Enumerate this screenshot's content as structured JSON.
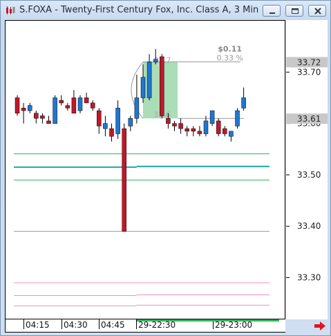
{
  "window": {
    "title": "S.FOXA - Twenty-First Century Fox, Inc. Class A, 3 Min",
    "buttons": {
      "minimize": "minimize",
      "maximize": "maximize",
      "close": "close"
    }
  },
  "price_axis": {
    "ticks": [
      "33.70",
      "33.60",
      "33.50",
      "33.40",
      "33.30"
    ],
    "last_price_label": "33.72",
    "marker_label": "33.61"
  },
  "time_axis": {
    "labels": [
      "04:15",
      "04:30",
      "04:45",
      "29-22:30",
      "29-23:00"
    ]
  },
  "annotation": {
    "change_value": "$0.11",
    "change_percent": "0.33 %",
    "low_label": "33.6",
    "high_label": "33.7"
  },
  "colors": {
    "up": "#1f77d0",
    "down": "#c0182a",
    "highlight": "#8fd19e",
    "hline_green": "#2db35a",
    "hline_teal": "#19a3a8",
    "hline_pink": "#f08fc0",
    "hline_gray": "#999999",
    "axis_marker": "#c8c8c8"
  },
  "icons": {
    "app": "candlestick-app-icon",
    "scroll": "red-right-arrow-icon"
  },
  "chart_data": {
    "type": "candlestick",
    "title": "S.FOXA - Twenty-First Century Fox, Inc. Class A, 3 Min",
    "yrange": [
      33.245,
      33.76
    ],
    "y_ticks": [
      33.7,
      33.6,
      33.5,
      33.4,
      33.3
    ],
    "x_labels": [
      "04:15",
      "04:30",
      "04:45",
      "29-22:30",
      "29-23:00"
    ],
    "candles": [
      {
        "o": 33.65,
        "h": 33.655,
        "l": 33.615,
        "c": 33.62
      },
      {
        "o": 33.63,
        "h": 33.64,
        "l": 33.6,
        "c": 33.625
      },
      {
        "o": 33.625,
        "h": 33.64,
        "l": 33.62,
        "c": 33.635
      },
      {
        "o": 33.62,
        "h": 33.625,
        "l": 33.6,
        "c": 33.61
      },
      {
        "o": 33.615,
        "h": 33.62,
        "l": 33.6,
        "c": 33.61
      },
      {
        "o": 33.605,
        "h": 33.615,
        "l": 33.6,
        "c": 33.6
      },
      {
        "o": 33.6,
        "h": 33.655,
        "l": 33.6,
        "c": 33.65
      },
      {
        "o": 33.645,
        "h": 33.655,
        "l": 33.635,
        "c": 33.64
      },
      {
        "o": 33.635,
        "h": 33.64,
        "l": 33.625,
        "c": 33.63
      },
      {
        "o": 33.65,
        "h": 33.665,
        "l": 33.625,
        "c": 33.62
      },
      {
        "o": 33.625,
        "h": 33.655,
        "l": 33.62,
        "c": 33.65
      },
      {
        "o": 33.65,
        "h": 33.66,
        "l": 33.64,
        "c": 33.64
      },
      {
        "o": 33.64,
        "h": 33.645,
        "l": 33.625,
        "c": 33.63
      },
      {
        "o": 33.625,
        "h": 33.63,
        "l": 33.58,
        "c": 33.595
      },
      {
        "o": 33.59,
        "h": 33.615,
        "l": 33.575,
        "c": 33.6
      },
      {
        "o": 33.59,
        "h": 33.6,
        "l": 33.565,
        "c": 33.575
      },
      {
        "o": 33.58,
        "h": 33.645,
        "l": 33.57,
        "c": 33.63
      },
      {
        "o": 33.59,
        "h": 33.6,
        "l": 33.39,
        "c": 33.39
      },
      {
        "o": 33.595,
        "h": 33.615,
        "l": 33.585,
        "c": 33.61
      },
      {
        "o": 33.61,
        "h": 33.695,
        "l": 33.6,
        "c": 33.65
      },
      {
        "o": 33.65,
        "h": 33.715,
        "l": 33.64,
        "c": 33.69
      },
      {
        "o": 33.65,
        "h": 33.735,
        "l": 33.645,
        "c": 33.72
      },
      {
        "o": 33.72,
        "h": 33.745,
        "l": 33.715,
        "c": 33.725
      },
      {
        "o": 33.73,
        "h": 33.735,
        "l": 33.61,
        "c": 33.615
      },
      {
        "o": 33.61,
        "h": 33.62,
        "l": 33.59,
        "c": 33.6
      },
      {
        "o": 33.6,
        "h": 33.605,
        "l": 33.585,
        "c": 33.595
      },
      {
        "o": 33.6,
        "h": 33.61,
        "l": 33.58,
        "c": 33.59
      },
      {
        "o": 33.59,
        "h": 33.595,
        "l": 33.575,
        "c": 33.585
      },
      {
        "o": 33.59,
        "h": 33.595,
        "l": 33.575,
        "c": 33.585
      },
      {
        "o": 33.585,
        "h": 33.595,
        "l": 33.575,
        "c": 33.58
      },
      {
        "o": 33.58,
        "h": 33.615,
        "l": 33.575,
        "c": 33.605
      },
      {
        "o": 33.6,
        "h": 33.625,
        "l": 33.595,
        "c": 33.625
      },
      {
        "o": 33.605,
        "h": 33.61,
        "l": 33.575,
        "c": 33.58
      },
      {
        "o": 33.59,
        "h": 33.595,
        "l": 33.575,
        "c": 33.58
      },
      {
        "o": 33.575,
        "h": 33.585,
        "l": 33.565,
        "c": 33.585
      },
      {
        "o": 33.595,
        "h": 33.63,
        "l": 33.59,
        "c": 33.625
      },
      {
        "o": 33.63,
        "h": 33.67,
        "l": 33.625,
        "c": 33.65
      }
    ],
    "hlines": [
      {
        "y": 33.541,
        "color": "hline_green",
        "segments": [
          [
            0.0,
            1.0
          ]
        ]
      },
      {
        "y": 33.515,
        "color": "hline_teal",
        "segments": [
          [
            0.0,
            0.48
          ],
          [
            0.48,
            1.0
          ]
        ]
      },
      {
        "y": 33.49,
        "color": "hline_green",
        "segments": [
          [
            0.0,
            1.0
          ]
        ]
      },
      {
        "y": 33.39,
        "color": "hline_gray",
        "segments": [
          [
            0.0,
            1.0
          ]
        ]
      },
      {
        "y": 33.29,
        "color": "hline_pink",
        "segments": [
          [
            0.0,
            1.0
          ]
        ]
      },
      {
        "y": 33.265,
        "color": "hline_pink",
        "segments": [
          [
            0.0,
            0.48
          ],
          [
            0.48,
            1.0
          ]
        ]
      },
      {
        "y": 33.245,
        "color": "hline_pink",
        "segments": [
          [
            0.0,
            0.48
          ],
          [
            0.48,
            1.0
          ]
        ]
      }
    ]
  }
}
